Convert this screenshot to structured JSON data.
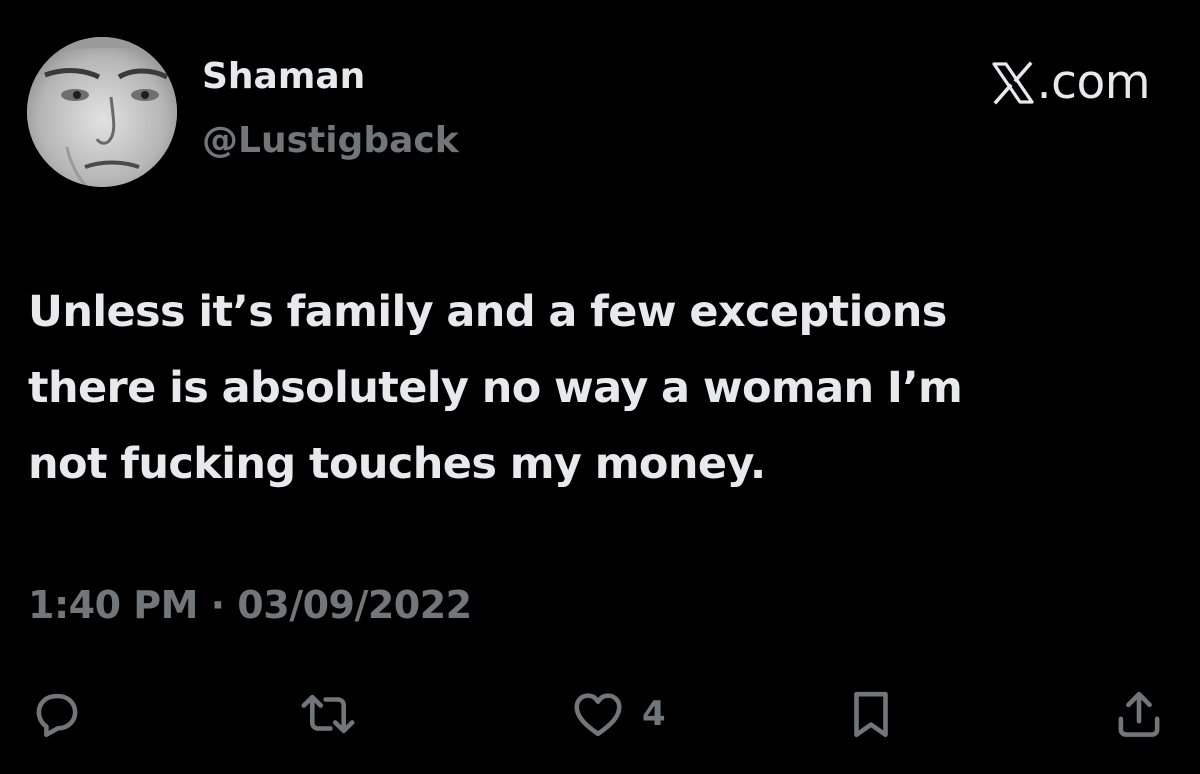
{
  "user": {
    "display_name": "Shaman",
    "handle": "@Lustigback"
  },
  "brand": {
    "text": ".com",
    "icon": "x-logo-icon"
  },
  "tweet": {
    "lines": [
      "Unless it’s family and a few exceptions",
      "there is absolutely no way a woman I’m",
      "not fucking touches my money."
    ]
  },
  "timestamp": "1:40 PM · 03/09/2022",
  "actions": {
    "reply": {
      "icon": "reply-icon"
    },
    "repost": {
      "icon": "repost-icon"
    },
    "like": {
      "icon": "heart-icon",
      "count": "4"
    },
    "bookmark": {
      "icon": "bookmark-icon"
    },
    "share": {
      "icon": "share-icon"
    }
  },
  "colors": {
    "background": "#000000",
    "primary_text": "#e7e9ea",
    "secondary_text": "#71767b"
  }
}
